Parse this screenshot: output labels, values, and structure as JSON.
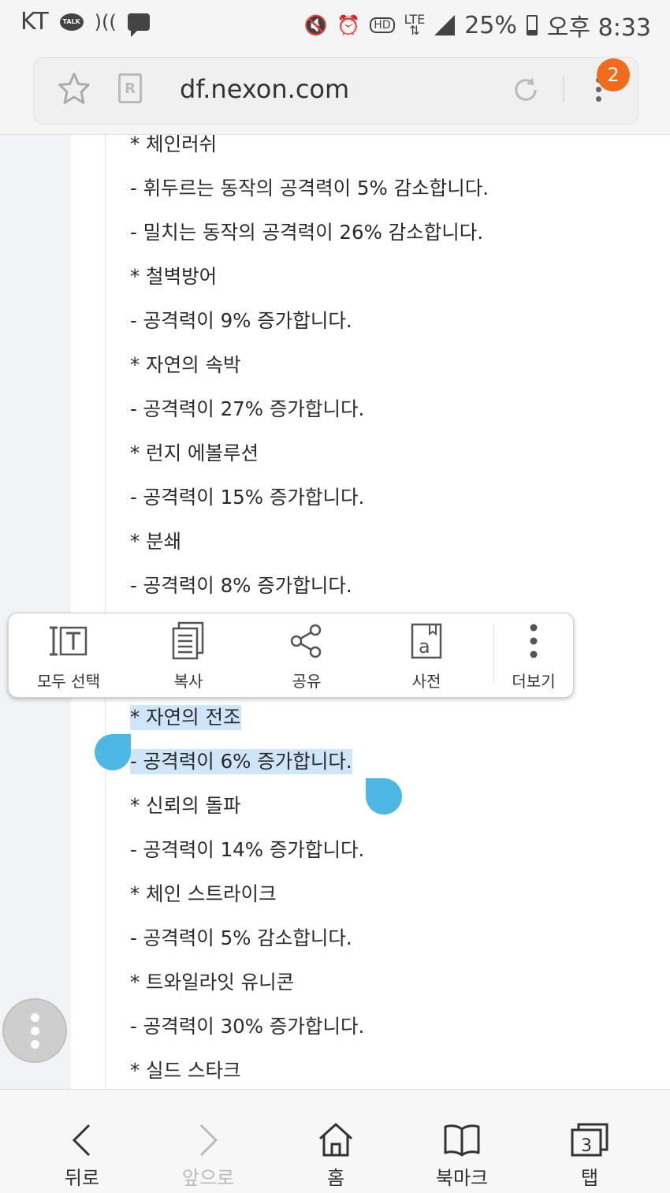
{
  "status_bar": {
    "carrier": "KT",
    "talk_label": "TALK",
    "hd_label": "HD",
    "network": "LTE",
    "battery": "25%",
    "time": "오후 8:33"
  },
  "browser": {
    "url": "df.nexon.com",
    "reader_label": "R",
    "notification_count": "2"
  },
  "content": {
    "lines": [
      "* 체인러쉬",
      "- 휘두르는 동작의 공격력이 5% 감소합니다.",
      "- 밀치는 동작의 공격력이 26% 감소합니다.",
      "* 철벽방어",
      "- 공격력이 9% 증가합니다.",
      "* 자연의 속박",
      "- 공격력이 27% 증가합니다.",
      "* 런지 에볼루션",
      "- 공격력이 15% 증가합니다.",
      "* 분쇄",
      "- 공격력이 8% 증가합니다.",
      "* 자연의 전조 ",
      "- 공격력이 6% 증가합니다.",
      "* 신뢰의 돌파",
      "- 공격력이 14% 증가합니다.",
      "* 체인 스트라이크",
      "- 공격력이 5% 감소합니다.",
      "* 트와일라잇 유니콘",
      "- 공격력이 30% 증가합니다.",
      "* 실드 스타크"
    ]
  },
  "context_menu": {
    "select_all": "모두 선택",
    "copy": "복사",
    "share": "공유",
    "dictionary": "사전",
    "more": "더보기"
  },
  "bottom_nav": {
    "back": "뒤로",
    "forward": "앞으로",
    "home": "홈",
    "bookmarks": "북마크",
    "tabs": "탭",
    "tab_count": "3"
  }
}
